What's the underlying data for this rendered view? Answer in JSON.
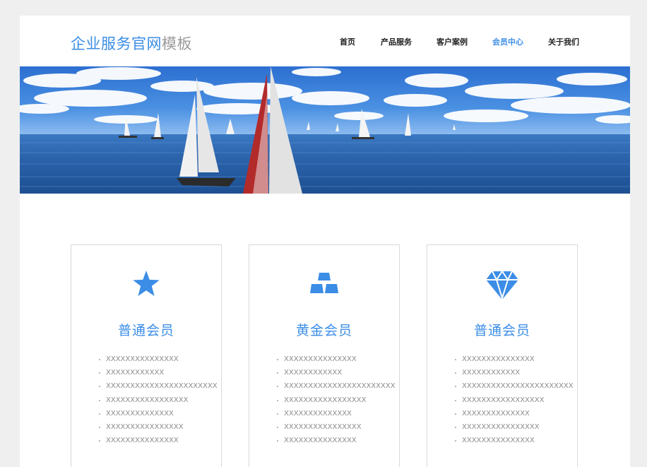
{
  "header": {
    "logo_primary": "企业服务官网",
    "logo_secondary": "模板",
    "nav": [
      {
        "label": "首页",
        "active": false
      },
      {
        "label": "产品服务",
        "active": false
      },
      {
        "label": "客户案例",
        "active": false
      },
      {
        "label": "会员中心",
        "active": true
      },
      {
        "label": "关于我们",
        "active": false
      }
    ]
  },
  "banner": {
    "image": "sailboats-on-sea-photo"
  },
  "cards": [
    {
      "icon": "star-icon",
      "title": "普通会员",
      "items": [
        "XXXXXXXXXXXXXXX",
        "XXXXXXXXXXXX",
        "XXXXXXXXXXXXXXXXXXXXXXX",
        "XXXXXXXXXXXXXXXXX",
        "XXXXXXXXXXXXXX",
        "XXXXXXXXXXXXXXXX",
        "XXXXXXXXXXXXXXX"
      ]
    },
    {
      "icon": "gold-bars-icon",
      "title": "黄金会员",
      "items": [
        "XXXXXXXXXXXXXXX",
        "XXXXXXXXXXXX",
        "XXXXXXXXXXXXXXXXXXXXXXX",
        "XXXXXXXXXXXXXXXXX",
        "XXXXXXXXXXXXXX",
        "XXXXXXXXXXXXXXXX",
        "XXXXXXXXXXXXXXX"
      ]
    },
    {
      "icon": "diamond-icon",
      "title": "普通会员",
      "items": [
        "XXXXXXXXXXXXXXX",
        "XXXXXXXXXXXX",
        "XXXXXXXXXXXXXXXXXXXXXXX",
        "XXXXXXXXXXXXXXXXX",
        "XXXXXXXXXXXXXX",
        "XXXXXXXXXXXXXXXX",
        "XXXXXXXXXXXXXXX"
      ]
    }
  ],
  "colors": {
    "accent": "#3b8de6",
    "logo_secondary": "#9a9a9a",
    "nav_text": "#222222",
    "list_text": "#8c8c8c",
    "page_bg": "#efefef"
  }
}
